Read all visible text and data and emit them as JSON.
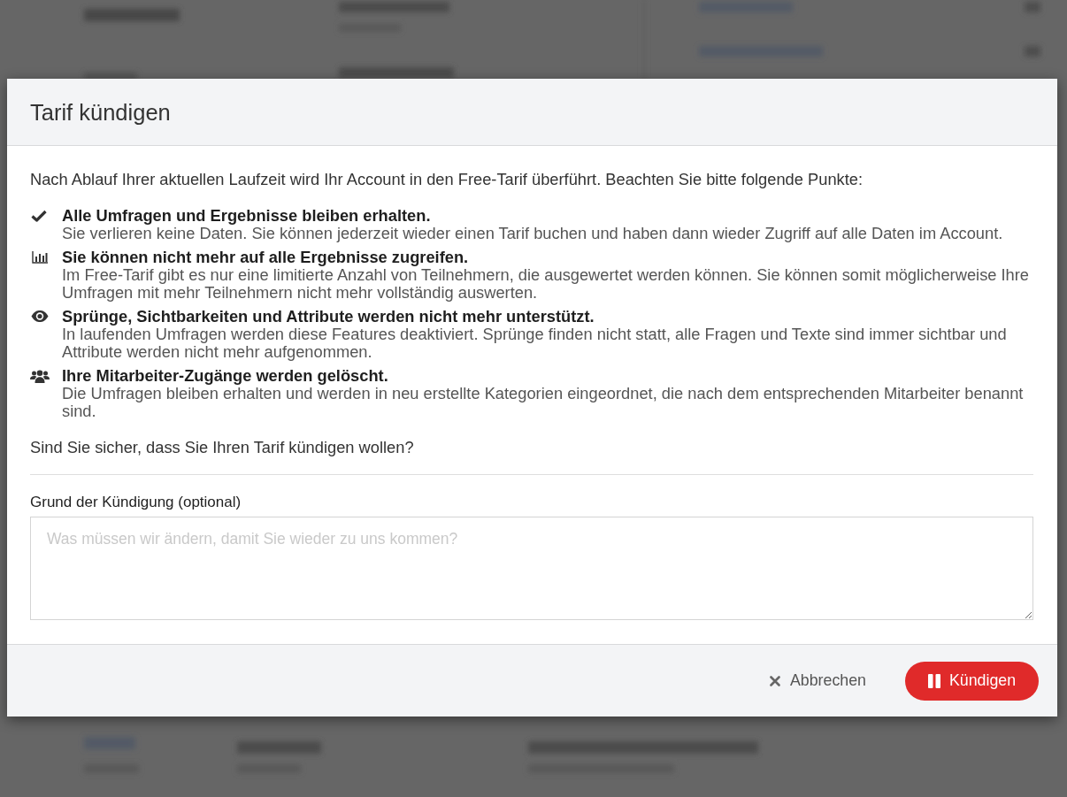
{
  "dialog": {
    "title": "Tarif kündigen",
    "intro": "Nach Ablauf Ihrer aktuellen Laufzeit wird Ihr Account in den Free-Tarif überführt. Beachten Sie bitte folgende Punkte:",
    "points": [
      {
        "kind": "check",
        "title": "Alle Umfragen und Ergebnisse bleiben erhalten.",
        "description": "Sie verlieren keine Daten. Sie können jederzeit wieder einen Tarif buchen und haben dann wieder Zugriff auf alle Daten im Account."
      },
      {
        "kind": "chart",
        "title": "Sie können nicht mehr auf alle Ergebnisse zugreifen.",
        "description": "Im Free-Tarif gibt es nur eine limitierte Anzahl von Teilnehmern, die ausgewertet werden können. Sie können somit möglicherweise Ihre Umfragen mit mehr Teilnehmern nicht mehr vollständig auswerten."
      },
      {
        "kind": "eye",
        "title": "Sprünge, Sichtbarkeiten und Attribute werden nicht mehr unterstützt.",
        "description": "In laufenden Umfragen werden diese Features deaktiviert. Sprünge finden nicht statt, alle Fragen und Texte sind immer sichtbar und Attribute werden nicht mehr aufgenommen."
      },
      {
        "kind": "users",
        "title": "Ihre Mitarbeiter-Zugänge werden gelöscht.",
        "description": "Die Umfragen bleiben erhalten und werden in neu erstellte Kategorien eingeordnet, die nach dem entsprechenden Mitarbeiter benannt sind."
      }
    ],
    "question": "Sind Sie sicher, dass Sie Ihren Tarif kündigen wollen?",
    "reason_field": {
      "label": "Grund der Kündigung (optional)",
      "placeholder": "Was müssen wir ändern, damit Sie wieder zu uns kommen?"
    },
    "buttons": [
      {
        "kind": "cancel",
        "label": "Abbrechen"
      },
      {
        "kind": "confirm",
        "label": "Kündigen"
      }
    ]
  }
}
